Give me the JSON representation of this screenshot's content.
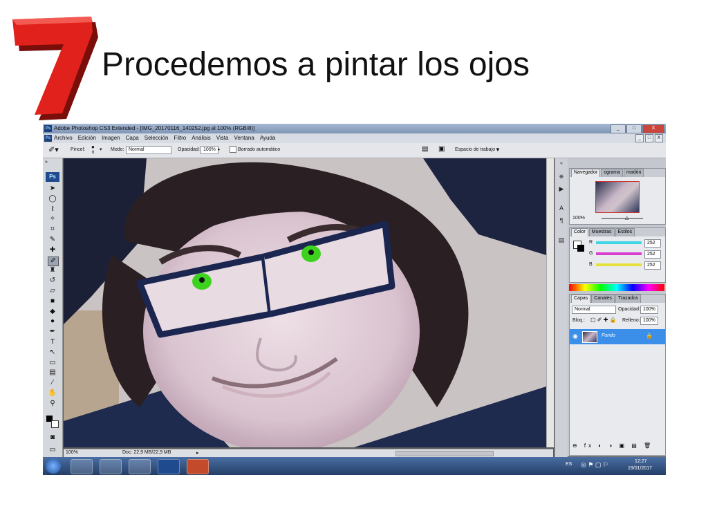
{
  "slide": {
    "number": "7",
    "title": "Procedemos a pintar los ojos"
  },
  "window": {
    "app_badge": "Ps",
    "title": "Adobe Photoshop CS3 Extended - [IMG_20170116_140252.jpg al 100% (RGB/8)]",
    "controls": [
      "_",
      "□",
      "X"
    ]
  },
  "menu": {
    "items": [
      "Archivo",
      "Edición",
      "Imagen",
      "Capa",
      "Selección",
      "Filtro",
      "Análisis",
      "Vista",
      "Ventana",
      "Ayuda"
    ],
    "doc_controls": [
      "_",
      "□",
      "X"
    ]
  },
  "options": {
    "brush_label": "Pincel:",
    "brush_size": "6",
    "mode_label": "Modo:",
    "mode_value": "Normal",
    "opacity_label": "Opacidad:",
    "opacity_value": "100%",
    "auto_erase_label": "Borrado automático",
    "workspace_label": "Espacio de trabajo"
  },
  "toolbox": {
    "logo": "Ps",
    "tools": [
      {
        "name": "move-tool-icon",
        "glyph": "➤"
      },
      {
        "name": "marquee-tool-icon",
        "glyph": "◯"
      },
      {
        "name": "lasso-tool-icon",
        "glyph": "ℓ"
      },
      {
        "name": "magic-wand-tool-icon",
        "glyph": "✧"
      },
      {
        "name": "crop-tool-icon",
        "glyph": "⌗"
      },
      {
        "name": "slice-tool-icon",
        "glyph": "✎"
      },
      {
        "name": "healing-tool-icon",
        "glyph": "✚"
      },
      {
        "name": "brush-tool-icon",
        "glyph": "✐",
        "selected": true
      },
      {
        "name": "stamp-tool-icon",
        "glyph": "♜"
      },
      {
        "name": "history-brush-tool-icon",
        "glyph": "↺"
      },
      {
        "name": "eraser-tool-icon",
        "glyph": "▱"
      },
      {
        "name": "gradient-tool-icon",
        "glyph": "■"
      },
      {
        "name": "blur-tool-icon",
        "glyph": "◆"
      },
      {
        "name": "dodge-tool-icon",
        "glyph": "●"
      },
      {
        "name": "pen-tool-icon",
        "glyph": "✒"
      },
      {
        "name": "type-tool-icon",
        "glyph": "T"
      },
      {
        "name": "path-select-tool-icon",
        "glyph": "↖"
      },
      {
        "name": "shape-tool-icon",
        "glyph": "▭"
      },
      {
        "name": "notes-tool-icon",
        "glyph": "▤"
      },
      {
        "name": "eyedropper-tool-icon",
        "glyph": "⁄"
      },
      {
        "name": "hand-tool-icon",
        "glyph": "✋"
      },
      {
        "name": "zoom-tool-icon",
        "glyph": "⚲"
      }
    ]
  },
  "status": {
    "zoom": "100%",
    "doc_size": "Doc: 22,9 MB/22,9 MB"
  },
  "navigator": {
    "tabs": [
      "Navegador",
      "ograma",
      "madón"
    ],
    "zoom": "100%"
  },
  "color": {
    "tabs": [
      "Color",
      "Muestras",
      "Estilos"
    ],
    "channels": [
      {
        "label": "R",
        "value": "252",
        "color": "#3fd7e6"
      },
      {
        "label": "G",
        "value": "252",
        "color": "#d83fd0"
      },
      {
        "label": "B",
        "value": "252",
        "color": "#e6e03a"
      }
    ]
  },
  "layers": {
    "tabs": [
      "Capas",
      "Canales",
      "Trazados"
    ],
    "blend_mode": "Normal",
    "opacity_label": "Opacidad:",
    "opacity_value": "100%",
    "lock_label": "Bloq.:",
    "fill_label": "Relleno:",
    "fill_value": "100%",
    "layer_name": "Fondo"
  },
  "taskbar": {
    "language": "ES",
    "time": "12:27",
    "date": "19/01/2017"
  },
  "colors": {
    "accent_blue": "#3c8fe8",
    "eye_green": "#3cd21e",
    "title_red": "#e0211c"
  }
}
